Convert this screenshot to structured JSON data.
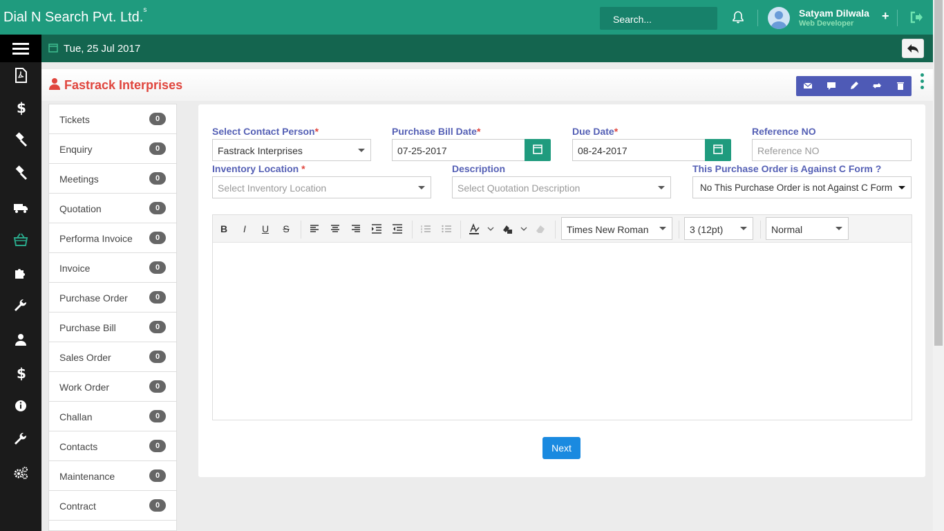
{
  "header": {
    "brand": "Dial N Search Pvt. Ltd.",
    "brand_sup": "s",
    "search_placeholder": "Search...",
    "user_name": "Satyam Dilwala",
    "user_role": "Web Developer",
    "plus": "+"
  },
  "subbar": {
    "date": "Tue, 25 Jul 2017"
  },
  "page": {
    "company": "Fastrack Interprises"
  },
  "list": [
    {
      "label": "Tickets",
      "count": "0"
    },
    {
      "label": "Enquiry",
      "count": "0"
    },
    {
      "label": "Meetings",
      "count": "0"
    },
    {
      "label": "Quotation",
      "count": "0"
    },
    {
      "label": "Performa Invoice",
      "count": "0"
    },
    {
      "label": "Invoice",
      "count": "0"
    },
    {
      "label": "Purchase Order",
      "count": "0"
    },
    {
      "label": "Purchase Bill",
      "count": "0"
    },
    {
      "label": "Sales Order",
      "count": "0"
    },
    {
      "label": "Work Order",
      "count": "0"
    },
    {
      "label": "Challan",
      "count": "0"
    },
    {
      "label": "Contacts",
      "count": "0"
    },
    {
      "label": "Maintenance",
      "count": "0"
    },
    {
      "label": "Contract",
      "count": "0"
    }
  ],
  "form": {
    "contact_label": "Select Contact Person",
    "contact_value": "Fastrack Interprises",
    "bill_date_label": "Purchase Bill Date",
    "bill_date_value": "07-25-2017",
    "due_date_label": "Due Date",
    "due_date_value": "08-24-2017",
    "ref_label": "Reference NO",
    "ref_placeholder": "Reference NO",
    "inventory_label": "Inventory Location",
    "inventory_placeholder": "Select Inventory Location",
    "desc_label": "Description",
    "desc_placeholder": "Select Quotation Description",
    "cform_label": "This Purchase Order is Against C Form ?",
    "cform_value": "No This Purchase Order is not Against C Form",
    "required_mark": "*"
  },
  "editor": {
    "bold": "B",
    "italic": "I",
    "underline": "U",
    "strike": "S",
    "font": "Times New Roman",
    "size": "3 (12pt)",
    "style": "Normal"
  },
  "next_label": "Next"
}
